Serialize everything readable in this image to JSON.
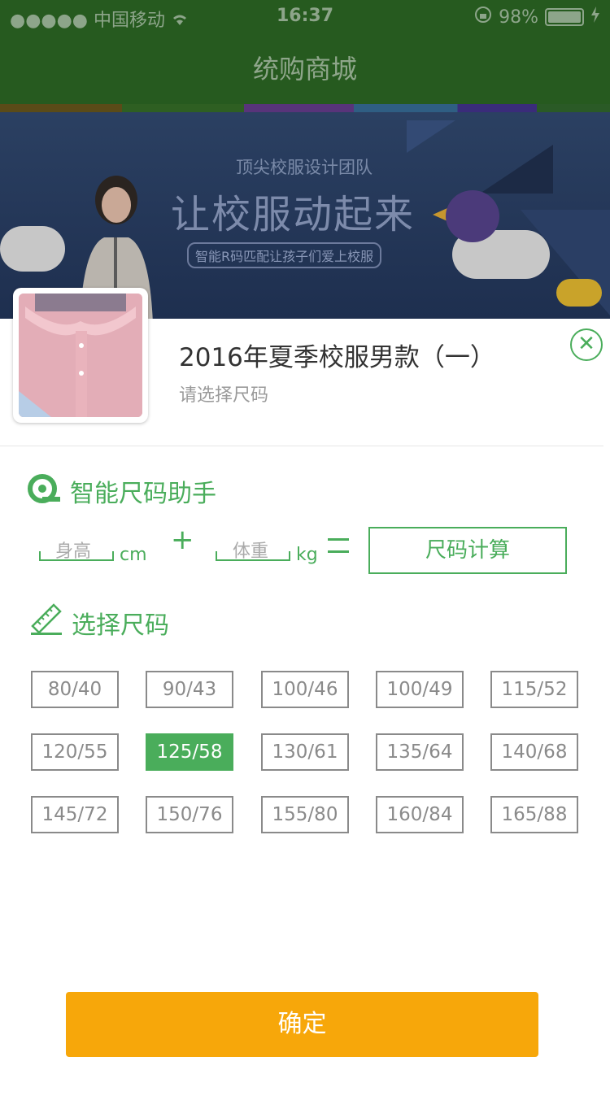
{
  "status_bar": {
    "signal": "●●●●●",
    "carrier": "中国移动",
    "time": "16:37",
    "battery_percent": "98%"
  },
  "nav": {
    "title": "统购商城"
  },
  "banner": {
    "tagline_top": "顶尖校服设计团队",
    "headline": "让校服动起来",
    "tagline_bottom": "智能R码匹配让孩子们爱上校服"
  },
  "product": {
    "title": "2016年夏季校服男款（一）",
    "subtitle": "请选择尺码"
  },
  "assistant": {
    "title": "智能尺码助手",
    "height_placeholder": "身高",
    "height_unit": "cm",
    "plus": "+",
    "weight_placeholder": "体重",
    "weight_unit": "kg",
    "calc_button": "尺码计算"
  },
  "size_section": {
    "title": "选择尺码"
  },
  "sizes": [
    "80/40",
    "90/43",
    "100/46",
    "100/49",
    "115/52",
    "120/55",
    "125/58",
    "130/61",
    "135/64",
    "140/68",
    "145/72",
    "150/76",
    "155/80",
    "160/84",
    "165/88"
  ],
  "selected_size": "125/58",
  "confirm_button": "确定",
  "colors": {
    "accent": "#4aad5b",
    "confirm": "#f7a70a"
  }
}
